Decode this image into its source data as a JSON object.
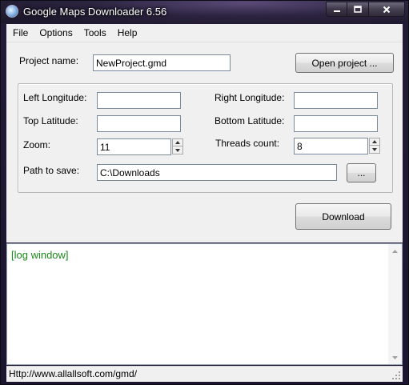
{
  "window": {
    "title": "Google Maps Downloader 6.56"
  },
  "menu": [
    "File",
    "Options",
    "Tools",
    "Help"
  ],
  "form": {
    "project_name_label": "Project name:",
    "project_name_value": "NewProject.gmd",
    "open_project_label": "Open project ...",
    "left_longitude_label": "Left Longitude:",
    "left_longitude_value": "",
    "right_longitude_label": "Right Longitude:",
    "right_longitude_value": "",
    "top_latitude_label": "Top Latitude:",
    "top_latitude_value": "",
    "bottom_latitude_label": "Bottom Latitude:",
    "bottom_latitude_value": "",
    "zoom_label": "Zoom:",
    "zoom_value": "11",
    "threads_label": "Threads count:",
    "threads_value": "8",
    "path_label": "Path to save:",
    "path_value": "C:\\Downloads",
    "browse_label": "...",
    "download_label": "Download"
  },
  "log": {
    "text": "[log window]",
    "color": "#1a8a1a"
  },
  "status": {
    "text": "Http://www.allallsoft.com/gmd/"
  },
  "icons": {
    "app": "globe-icon",
    "minimize": "minimize-icon",
    "maximize": "maximize-icon",
    "close": "close-icon",
    "spin_up": "spin-up-icon",
    "spin_down": "spin-down-icon",
    "scroll_up": "scroll-up-icon",
    "scroll_down": "scroll-down-icon",
    "grip": "resize-grip-icon"
  }
}
